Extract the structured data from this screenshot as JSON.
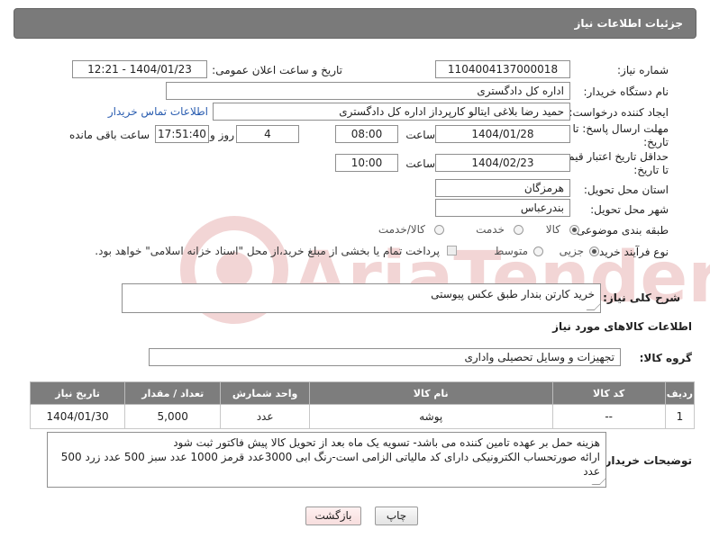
{
  "header": {
    "title": "جزئیات اطلاعات نیاز"
  },
  "fields": {
    "need_number_label": "شماره نیاز:",
    "need_number": "1104004137000018",
    "announce_label": "تاریخ و ساعت اعلان عمومی:",
    "announce_value": "1404/01/23 - 12:21",
    "buyer_org_label": "نام دستگاه خریدار:",
    "buyer_org": "اداره کل دادگستری",
    "requester_label": "ایجاد کننده درخواست:",
    "requester": "حمید رضا  بلاغی ایتالو کارپرداز اداره کل دادگستری",
    "contact_link": "اطلاعات تماس خریدار",
    "deadline_label_1": "مهلت ارسال پاسخ: تا",
    "deadline_label_2": "تاریخ:",
    "deadline_date": "1404/01/28",
    "time_label": "ساعت",
    "deadline_time": "08:00",
    "days_value": "4",
    "days_label": "روز و",
    "remaining_time": "17:51:40",
    "remaining_label": "ساعت باقی مانده",
    "validity_label_1": "حداقل تاریخ اعتبار قیمت:",
    "validity_label_2": "تا تاریخ:",
    "validity_date": "1404/02/23",
    "validity_time": "10:00",
    "province_label": "استان محل تحویل:",
    "province": "هرمزگان",
    "city_label": "شهر محل تحویل:",
    "city": "بندرعباس",
    "category_label": "طبقه بندی موضوعی:",
    "category_options": [
      "کالا",
      "خدمت",
      "کالا/خدمت"
    ],
    "process_label": "نوع فرآیند خرید :",
    "process_options": [
      "جزیی",
      "متوسط"
    ],
    "payment_note": "پرداخت تمام یا بخشی از مبلغ خرید،از محل \"اسناد خزانه اسلامی\" خواهد بود."
  },
  "description": {
    "label": "شرح کلی نیاز:",
    "value": "خرید کارتن بندار طبق عکس پیوستی"
  },
  "goods_section": {
    "title": "اطلاعات کالاهای مورد نیاز",
    "group_label": "گروه کالا:",
    "group_value": "تجهیزات و وسایل تحصیلی واداری"
  },
  "table": {
    "headers": [
      "ردیف",
      "کد کالا",
      "نام کالا",
      "واحد شمارش",
      "تعداد / مقدار",
      "تاریخ نیاز"
    ],
    "rows": [
      [
        "1",
        "--",
        "پوشه",
        "عدد",
        "5,000",
        "1404/01/30"
      ]
    ]
  },
  "buyer_notes": {
    "label": "توضیحات خریدار:",
    "line1": "هزینه حمل بر عهده تامین کننده می باشد- تسویه یک ماه بعد از تحویل کالا پیش فاکتور ثبت شود",
    "line2": "ارائه صورتحساب الکترونیکی دارای کد مالیاتی الزامی است-رنگ ابی 3000عدد قرمز 1000 عدد سبز 500 عدد زرد 500 عدد"
  },
  "buttons": {
    "print": "چاپ",
    "back": "بازگشت"
  },
  "watermark": {
    "text": "AriaTender.neT"
  },
  "colors": {
    "header_bg": "#7a7a7a",
    "link": "#2a5db0",
    "back_button_bg": "#fde8e8"
  }
}
